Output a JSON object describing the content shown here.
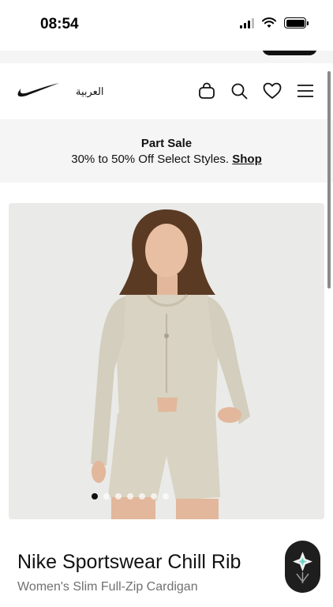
{
  "status_bar": {
    "time": "08:54",
    "icons": [
      "signal-icon",
      "wifi-icon",
      "battery-icon"
    ]
  },
  "header": {
    "logo": "nike-swoosh-logo",
    "language_link": "العربية",
    "icons": [
      "bag-icon",
      "search-icon",
      "heart-icon",
      "menu-icon"
    ]
  },
  "promo": {
    "title": "Part Sale",
    "text": "30% to 50% Off Select Styles. ",
    "link": "Shop"
  },
  "carousel": {
    "image_count": 7,
    "active_index": 0
  },
  "product": {
    "name": "Nike Sportswear Chill Rib",
    "subtitle": "Women's Slim Full-Zip Cardigan"
  },
  "colors": {
    "brand_black": "#111111",
    "promo_background": "#f5f5f5",
    "image_background": "#eaeae8",
    "subtitle_gray": "#707072"
  }
}
